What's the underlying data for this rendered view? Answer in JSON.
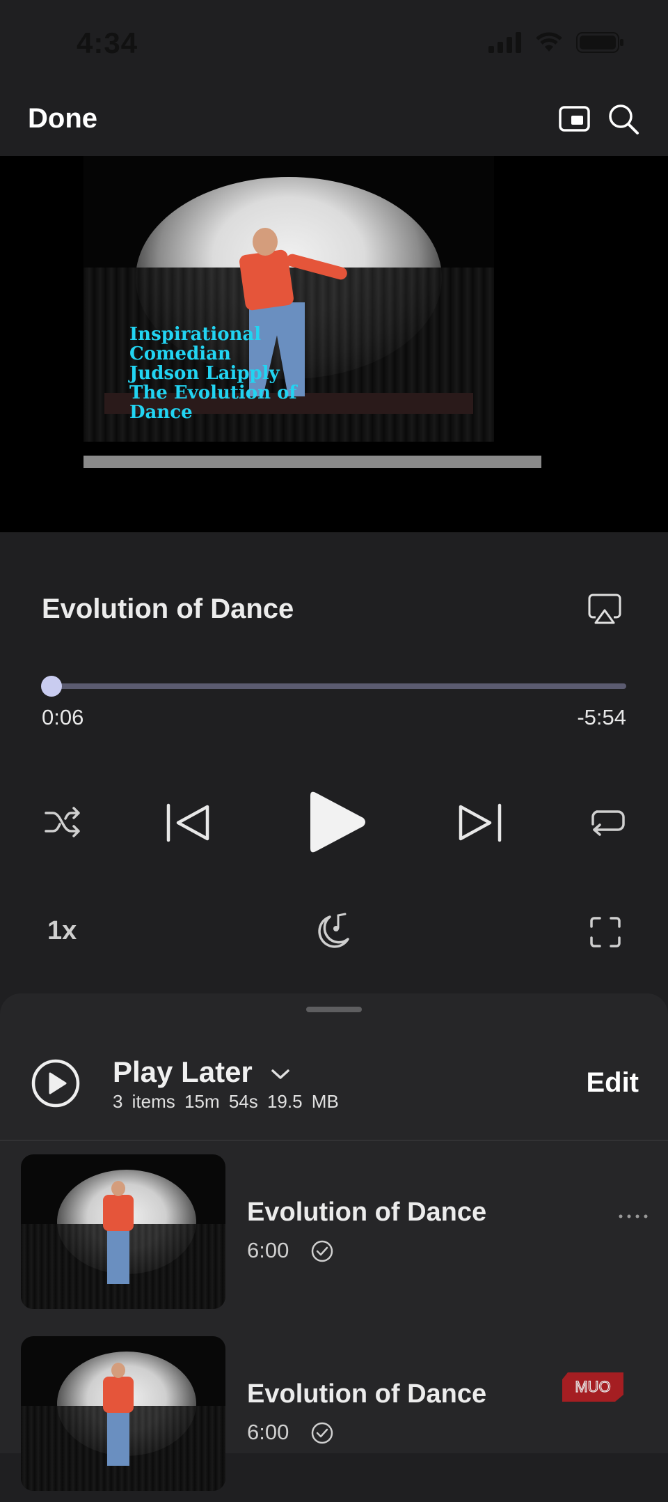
{
  "status_bar": {
    "time": "4:34"
  },
  "nav": {
    "done_label": "Done"
  },
  "video": {
    "caption": "Inspirational\nComedian\nJudson Laipply\nThe Evolution of\nDance"
  },
  "now_playing": {
    "title": "Evolution of Dance",
    "elapsed": "0:06",
    "remaining": "-5:54",
    "progress": 0.017,
    "speed": "1x"
  },
  "playlist": {
    "title": "Play Later",
    "meta": "3 items  15m 54s  19.5 MB",
    "edit_label": "Edit",
    "items": [
      {
        "title": "Evolution of Dance",
        "duration": "6:00",
        "downloaded": true
      },
      {
        "title": "Evolution of Dance",
        "duration": "6:00",
        "downloaded": true
      }
    ]
  },
  "watermark": {
    "text": "MUO"
  },
  "colors": {
    "background": "#1f1f21",
    "sheet": "#262628",
    "accent": "#c9ccf0",
    "track": "#5b5b70",
    "caption": "#22d4f2"
  },
  "icons": [
    "pip-icon",
    "search-icon",
    "airplay-icon",
    "shuffle-icon",
    "previous-icon",
    "play-icon",
    "next-icon",
    "repeat-icon",
    "sleep-timer-icon",
    "fullscreen-icon",
    "play-circle-icon",
    "chevron-down-icon",
    "checkmark-circle-icon",
    "more-icon"
  ]
}
